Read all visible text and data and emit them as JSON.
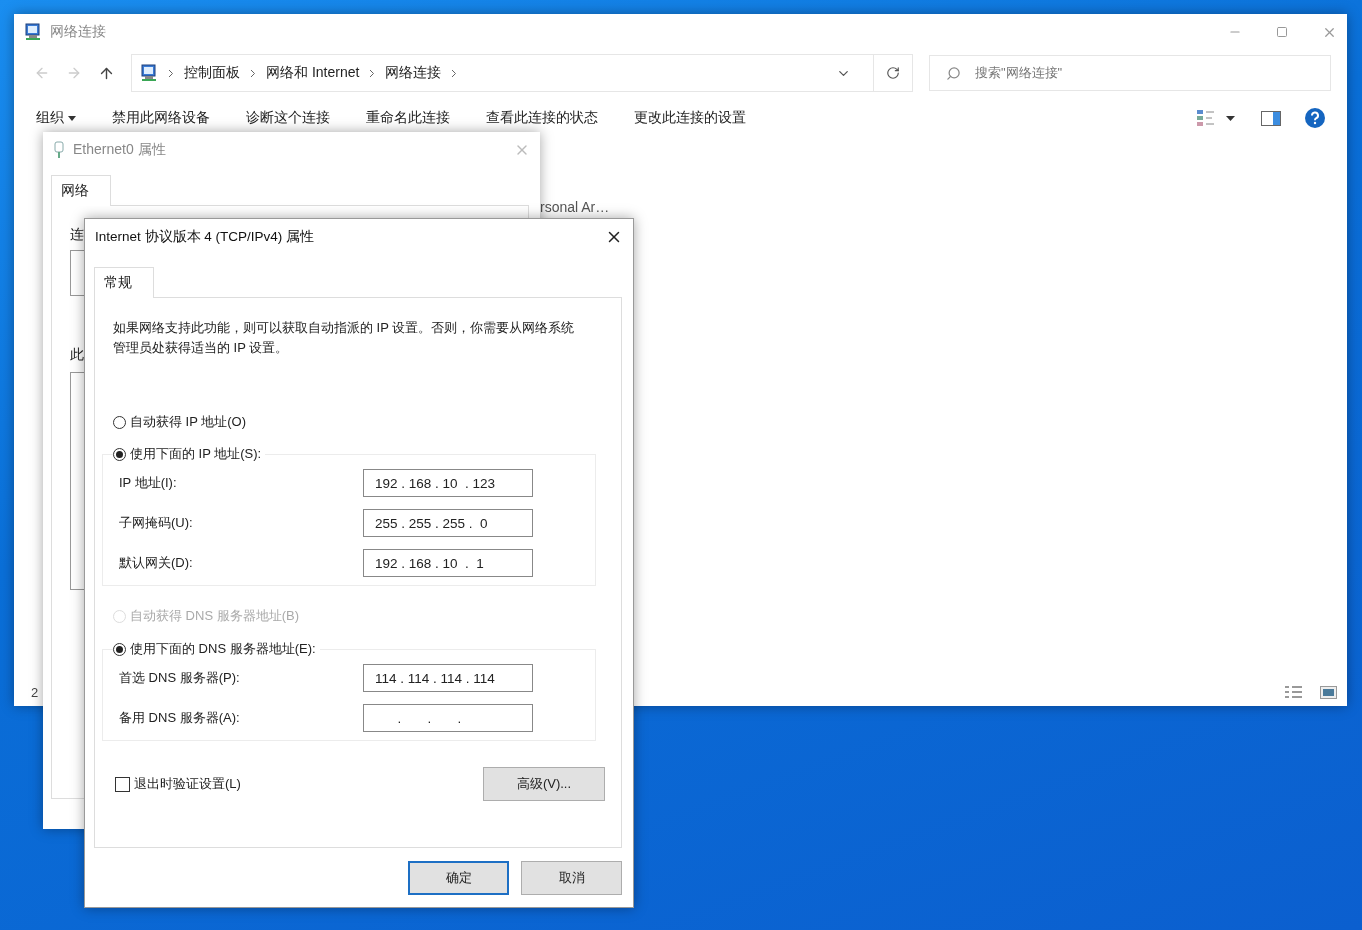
{
  "explorer": {
    "title": "网络连接",
    "nav": [
      {
        "kind": "back",
        "disabled": true
      },
      {
        "kind": "forward",
        "disabled": true
      },
      {
        "kind": "up",
        "disabled": false
      }
    ],
    "breadcrumb": [
      "控制面板",
      "网络和 Internet",
      "网络连接"
    ],
    "search": {
      "placeholder": "搜索\"网络连接\""
    },
    "toolbar": [
      {
        "label": "组织",
        "kind": "menu"
      },
      {
        "label": "禁用此网络设备",
        "kind": "command"
      },
      {
        "label": "诊断这个连接",
        "kind": "command"
      },
      {
        "label": "重命名此连接",
        "kind": "command"
      },
      {
        "label": "查看此连接的状态",
        "kind": "command"
      },
      {
        "label": "更改此连接的设置",
        "kind": "command"
      }
    ],
    "item_fragment": "rsonal Ar…",
    "status": "2"
  },
  "ethernet_dialog": {
    "title": "Ethernet0 属性",
    "tabs": [
      {
        "label": "网络",
        "selected": true
      }
    ],
    "labels": [
      "连",
      "此"
    ]
  },
  "ipv4_dialog": {
    "title": "Internet 协议版本 4 (TCP/IPv4) 属性",
    "tabs": [
      {
        "label": "常规",
        "selected": true
      }
    ],
    "description": "如果网络支持此功能，则可以获取自动指派的 IP 设置。否则，你需要从网络系统管理员处获得适当的 IP 设置。",
    "ip_options": [
      {
        "label": "自动获得 IP 地址(O)",
        "selected": false,
        "disabled": false
      },
      {
        "label": "使用下面的 IP 地址(S):",
        "selected": true,
        "disabled": false
      }
    ],
    "ip_fields": [
      {
        "label": "IP 地址(I):",
        "value": "192 . 168 . 10  . 123"
      },
      {
        "label": "子网掩码(U):",
        "value": "255 . 255 . 255 .  0"
      },
      {
        "label": "默认网关(D):",
        "value": "192 . 168 . 10  .  1"
      }
    ],
    "dns_options": [
      {
        "label": "自动获得 DNS 服务器地址(B)",
        "selected": false,
        "disabled": true
      },
      {
        "label": "使用下面的 DNS 服务器地址(E):",
        "selected": true,
        "disabled": false
      }
    ],
    "dns_fields": [
      {
        "label": "首选 DNS 服务器(P):",
        "value": "114 . 114 . 114 . 114"
      },
      {
        "label": "备用 DNS 服务器(A):",
        "value": "      .       .       ."
      }
    ],
    "validate": {
      "label": "退出时验证设置(L)",
      "checked": false
    },
    "advanced_button": "高级(V)...",
    "buttons": [
      {
        "label": "确定",
        "default": true
      },
      {
        "label": "取消",
        "default": false
      }
    ]
  }
}
